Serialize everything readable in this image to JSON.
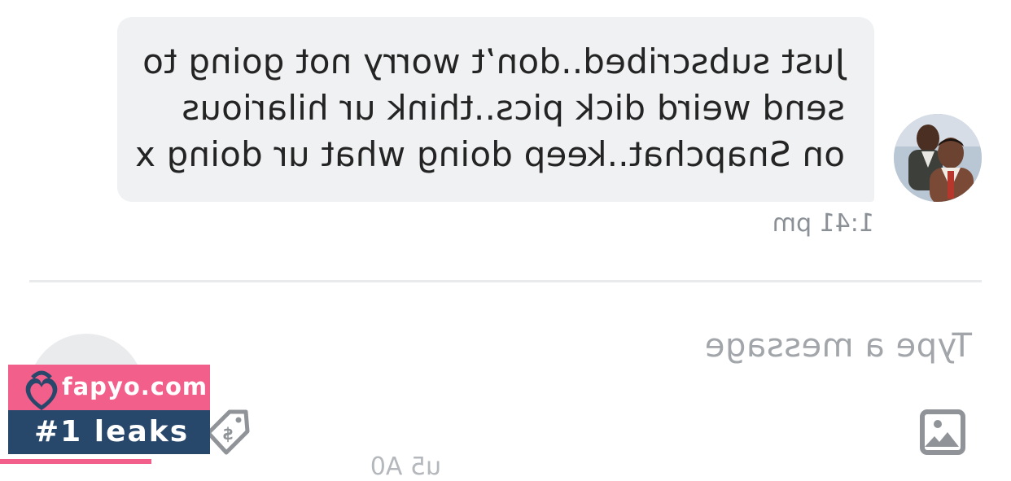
{
  "message": {
    "lines": [
      "Just subscribed..don’t worry not going to",
      "send weird dick pics..think ur hilarious",
      "on Snapchat..keep doing what ur doing x"
    ],
    "time": "1:41 pm"
  },
  "composer": {
    "placeholder": "Type a message",
    "image_icon": "image-icon",
    "tag_icon": "price-tag-icon",
    "truncated_text": "u5 A0"
  },
  "watermark": {
    "site": "fapyo.com",
    "tagline": "#1 leaks",
    "colors": {
      "pink": "#f35f8b",
      "navy": "#27476b"
    }
  },
  "colors": {
    "bubble": "#eff1f2",
    "text": "#242424",
    "timestamp": "#8a9096",
    "placeholder": "#a2a6aa"
  }
}
